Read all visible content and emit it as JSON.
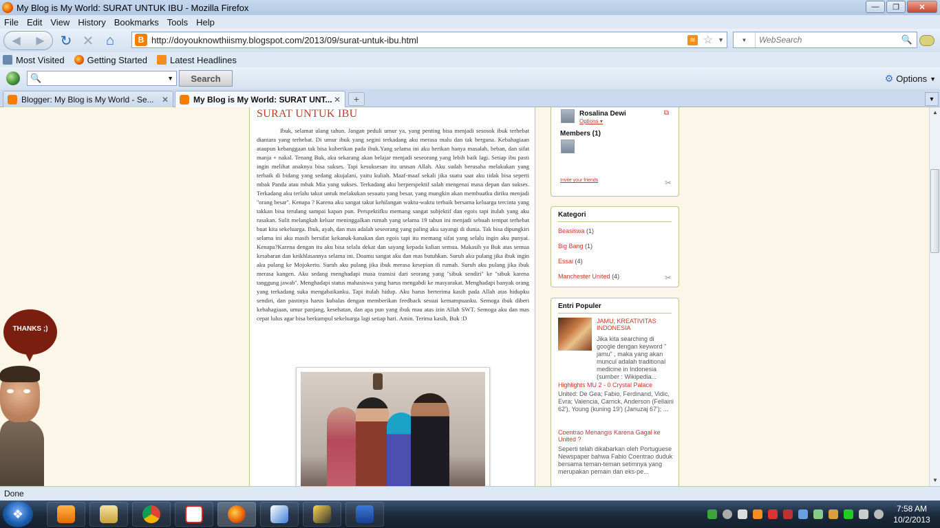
{
  "window": {
    "title": "My Blog is My World: SURAT UNTUK IBU - Mozilla Firefox"
  },
  "menu": {
    "items": [
      "File",
      "Edit",
      "View",
      "History",
      "Bookmarks",
      "Tools",
      "Help"
    ]
  },
  "nav": {
    "url": "http://doyouknowthiismy.blogspot.com/2013/09/surat-untuk-ibu.html",
    "websearch_placeholder": "WebSearch"
  },
  "bookmarks": {
    "items": [
      {
        "label": "Most Visited",
        "icon": "most-visited-icon"
      },
      {
        "label": "Getting Started",
        "icon": "firefox-icon"
      },
      {
        "label": "Latest Headlines",
        "icon": "rss-icon"
      }
    ]
  },
  "searchbar": {
    "button": "Search",
    "options": "Options"
  },
  "tabs": [
    {
      "label": "Blogger: My Blog is My World - Se...",
      "active": false
    },
    {
      "label": "My Blog is My World: SURAT UNT...",
      "active": true
    }
  ],
  "post": {
    "title": "SURAT UNTUK IBU",
    "body": "Ibuk, selamat ulang tahun. Jangan peduli umur ya, yang penting bisa menjadi sesosok ibuk terhebat diantara yang terhebat. Di umur ibuk yang segini terkadang aku merasa malu dan tak berguna. Kebahagiaan ataupun kebanggaan tak bisa kuberikan pada ibuk.Yang selama ini aku berikan hanya masalah, beban, dan sifat manja + nakal. Tenang Buk, aku sekarang akan belajar menjadi seseorang yang lebih baik lagi. Setiap ibu pasti ingin melihat anaknya bisa sukses. Tapi kesuksesan itu urusan Allah. Aku sudah berusaha melakukan yang terbaik di bidang yang sedang akujalani, yaitu kuliah. Maaf-maaf sekali jika suatu saat aku tidak bisa seperti mbak Panda atau mbak Mia yang sukses. Terkadang aku berperspektif salah mengenai masa depan dan sukses. Terkadang aku terlalu takut untuk melakukan sesuatu yang besar, yang mungkin akan membuatku diriku menjadi ''orang besar''. Kenapa ? Karena aku sangat takut kehilangan waktu-waktu terbaik bersama keluarga tercinta yang takkan bisa terulang sampai kapan pun. Perspektifku memang sangat subjektif dan egois tapi itulah yang aku rasakan. Sulit melangkah keluar meninggalkan rumah yang selama 19 tahun ini menjadi sebuah tempat terhebat buat kita sekeluarga. Ibuk, ayah, dan mas adalah seseorang yang paling aku sayangi di dunia. Tak bisa dipungkiri selama ini aku masih bersifat kekanak-kanakan dan egois tapi itu memang sifat yang selalu ingin aku punyai. Kenapa?Karena dengan itu aku bisa selalu dekat dan sayang kepada kalian semua. Makasih ya Buk atas semua kesabaran dan keikhlasannya selama ini. Doamu sangat aku dan mas butuhkan. Suruh aku pulang jika ibuk ingin aku pulang ke Mojokerto. Suruh aku pulang jika ibuk merasa kesepian di rumah. Suruh aku pulang jika ibuk merasa kangen. Aku sedang menghadapi masa transisi dari seorang yang ''sibuk sendiri'' ke ''sibuk karena tanggung jawab''. Menghadapi status mahasiswa yang harus mengabdi ke masyarakat. Menghadapi banyak orang yang terkadang suka mengabaikanku. Tapi itulah hidup. Aku harus berterima kasih pada Allah atas hidupku sendiri, dan pastinya harus kubalas dengan memberikan feedback sesuai kemampuanku. Semoga ibuk diberi kebahagiaan, umur panjang, kesehatan, dan apa pun yang ibuk mau atas izin Allah SWT. Semoga aku dan mas cepat lulus agar bisa berkumpul sekeluarga lagi setiap hari. Amin. Terima kasih, Buk :D"
  },
  "sidebar": {
    "members_widget": {
      "user_name": "Rosalina Dewi",
      "options": "Options",
      "members_title": "Members (1)",
      "invite": "Invite your friends"
    },
    "kategori": {
      "title": "Kategori",
      "items": [
        {
          "name": "Beasiswa",
          "count": "(1)"
        },
        {
          "name": "Big Bang",
          "count": "(1)"
        },
        {
          "name": "Essai",
          "count": "(4)"
        },
        {
          "name": "Manchester United",
          "count": "(4)"
        }
      ]
    },
    "populer": {
      "title": "Entri Populer",
      "items": [
        {
          "title": "JAMU, KREATIVITAS INDONESIA",
          "snippet": "Jika kita searching di google dengan keyword \" jamu\" , maka yang akan muncul adalah traditional medicine in Indonesia (sumber : Wikipedia..."
        },
        {
          "title": "Highlights MU 2 - 0 Crystal Palace",
          "snippet": "United: De Gea; Fabio, Ferdinand, Vidic, Evra; Valencia, Carrick, Anderson (Fellaini 62'), Young (kuning 19') (Januzaj 67'); ..."
        },
        {
          "title": "Coentrao Menangis Karena Gagal ke United ?",
          "snippet": "Seperti telah dikabarkan oleh Portuguese Newspaper bahwa Fabio Coentrao duduk bersama teman-teman setimnya yang merupakan pemain dan eks-pe..."
        }
      ]
    }
  },
  "decoration": {
    "bubble": "THANKS ;)"
  },
  "status": {
    "text": "Done"
  },
  "taskbar": {
    "time": "7:58 AM",
    "date": "10/2/2013"
  }
}
